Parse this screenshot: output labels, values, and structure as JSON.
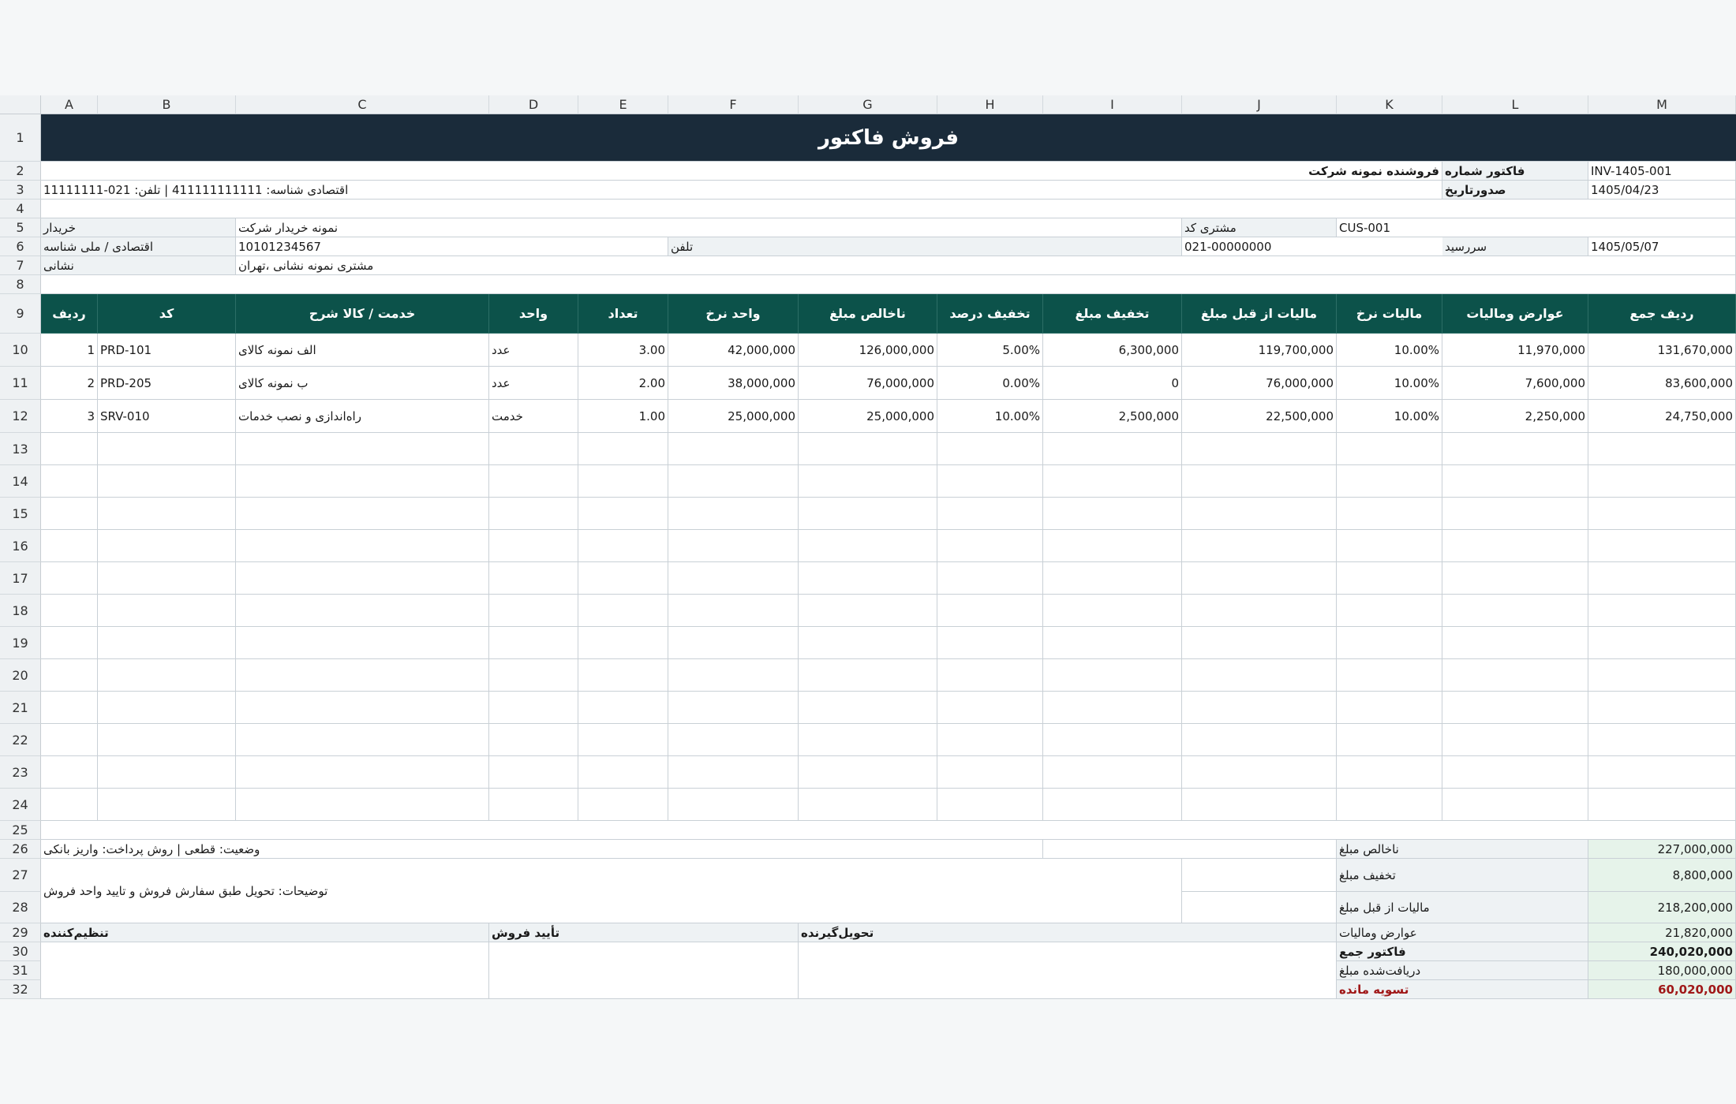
{
  "columns": [
    "A",
    "B",
    "C",
    "D",
    "E",
    "F",
    "G",
    "H",
    "I",
    "J",
    "K",
    "L",
    "M"
  ],
  "rows": [
    "1",
    "2",
    "3",
    "4",
    "5",
    "6",
    "7",
    "8",
    "9",
    "10",
    "11",
    "12",
    "13",
    "14",
    "15",
    "16",
    "17",
    "18",
    "19",
    "20",
    "21",
    "22",
    "23",
    "24",
    "25",
    "26",
    "27",
    "28",
    "29",
    "30",
    "31",
    "32"
  ],
  "title": "فروش فاکتور",
  "header": {
    "seller": "فروشنده نمونه شرکت",
    "invoice_no_label": "فاکتور شماره",
    "invoice_no": "INV-1405-001",
    "seller_contact": "اقتصادی شناسه: 411111111111 | تلفن: 021-11111111",
    "issue_date_label": "صدورتاریخ",
    "issue_date": "1405/04/23"
  },
  "buyer": {
    "buyer_label": "خریدار",
    "buyer_name": "نمونه خریدار شرکت",
    "customer_code_label": "مشتری کد",
    "customer_code": "CUS-001",
    "national_id_label": "اقتصادی / ملی شناسه",
    "national_id": "10101234567",
    "phone_label": "تلفن",
    "phone": "021-00000000",
    "due_label": "سررسید",
    "due_date": "1405/05/07",
    "address_label": "نشانی",
    "address": "مشتری نمونه نشانی ،تهران"
  },
  "table": {
    "headers": [
      "ردیف",
      "کد",
      "خدمت / کالا شرح",
      "واحد",
      "تعداد",
      "واحد نرخ",
      "ناخالص مبلغ",
      "تخفیف درصد",
      "تخفیف مبلغ",
      "مالیات از قبل مبلغ",
      "مالیات نرخ",
      "عوارض ومالیات",
      "ردیف جمع"
    ],
    "rows": [
      [
        "1",
        "PRD-101",
        "الف نمونه کالای",
        "عدد",
        "3.00",
        "42,000,000",
        "126,000,000",
        "5.00%",
        "6,300,000",
        "119,700,000",
        "10.00%",
        "11,970,000",
        "131,670,000"
      ],
      [
        "2",
        "PRD-205",
        "ب نمونه کالای",
        "عدد",
        "2.00",
        "38,000,000",
        "76,000,000",
        "0.00%",
        "0",
        "76,000,000",
        "10.00%",
        "7,600,000",
        "83,600,000"
      ],
      [
        "3",
        "SRV-010",
        "راه‌اندازی و نصب خدمات",
        "خدمت",
        "1.00",
        "25,000,000",
        "25,000,000",
        "10.00%",
        "2,500,000",
        "22,500,000",
        "10.00%",
        "2,250,000",
        "24,750,000"
      ]
    ]
  },
  "footer": {
    "status": "وضعیت: قطعی | روش پرداخت: واریز بانکی",
    "notes": "توضیحات: تحویل طبق سفارش فروش و تایید واحد فروش",
    "sig_preparer": "تنظیم‌کننده",
    "sig_sales": "تأیید فروش",
    "sig_receiver": "تحویل‌گیرنده"
  },
  "summary": [
    {
      "label": "ناخالص مبلغ",
      "value": "227,000,000"
    },
    {
      "label": "تخفیف مبلغ",
      "value": "8,800,000"
    },
    {
      "label": "مالیات از قبل مبلغ",
      "value": "218,200,000"
    },
    {
      "label": "عوارض ومالیات",
      "value": "21,820,000"
    },
    {
      "label": "فاکتور جمع",
      "value": "240,020,000"
    },
    {
      "label": "دریافت‌شده مبلغ",
      "value": "180,000,000"
    },
    {
      "label": "تسویه مانده",
      "value": "60,020,000"
    }
  ],
  "colors": {
    "title_bg": "#1a2b3a",
    "header_bg": "#0c524a",
    "total_bg": "#e6f3ea",
    "balance_text": "#a01818"
  }
}
